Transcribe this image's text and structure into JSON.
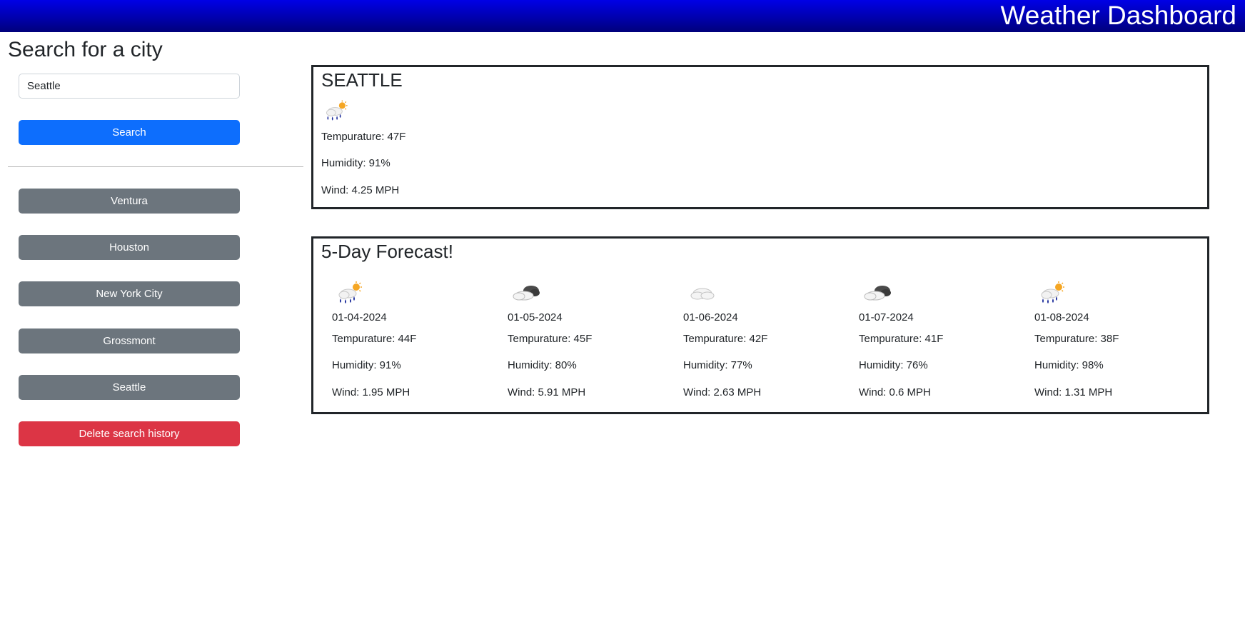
{
  "header": {
    "title": "Weather Dashboard"
  },
  "search": {
    "heading": "Search for a city",
    "input_value": "Seattle",
    "button_label": "Search"
  },
  "history": {
    "items": [
      "Ventura",
      "Houston",
      "New York City",
      "Grossmont",
      "Seattle"
    ],
    "delete_label": "Delete search history"
  },
  "current": {
    "city": "SEATTLE",
    "icon": "rain-sun-icon",
    "temperature": "Tempurature: 47F",
    "humidity": "Humidity: 91%",
    "wind": "Wind: 4.25 MPH"
  },
  "forecast": {
    "title": "5-Day Forecast!",
    "days": [
      {
        "date": "01-04-2024",
        "icon": "rain-sun-icon",
        "temperature": "Tempurature: 44F",
        "humidity": "Humidity: 91%",
        "wind": "Wind: 1.95 MPH"
      },
      {
        "date": "01-05-2024",
        "icon": "broken-clouds-icon",
        "temperature": "Tempurature: 45F",
        "humidity": "Humidity: 80%",
        "wind": "Wind: 5.91 MPH"
      },
      {
        "date": "01-06-2024",
        "icon": "cloud-icon",
        "temperature": "Tempurature: 42F",
        "humidity": "Humidity: 77%",
        "wind": "Wind: 2.63 MPH"
      },
      {
        "date": "01-07-2024",
        "icon": "broken-clouds-icon",
        "temperature": "Tempurature: 41F",
        "humidity": "Humidity: 76%",
        "wind": "Wind: 0.6 MPH"
      },
      {
        "date": "01-08-2024",
        "icon": "rain-sun-icon",
        "temperature": "Tempurature: 38F",
        "humidity": "Humidity: 98%",
        "wind": "Wind: 1.31 MPH"
      }
    ]
  },
  "colors": {
    "header": "#0000c8",
    "primary": "#0d6efd",
    "secondary": "#6c757d",
    "danger": "#dc3545"
  }
}
